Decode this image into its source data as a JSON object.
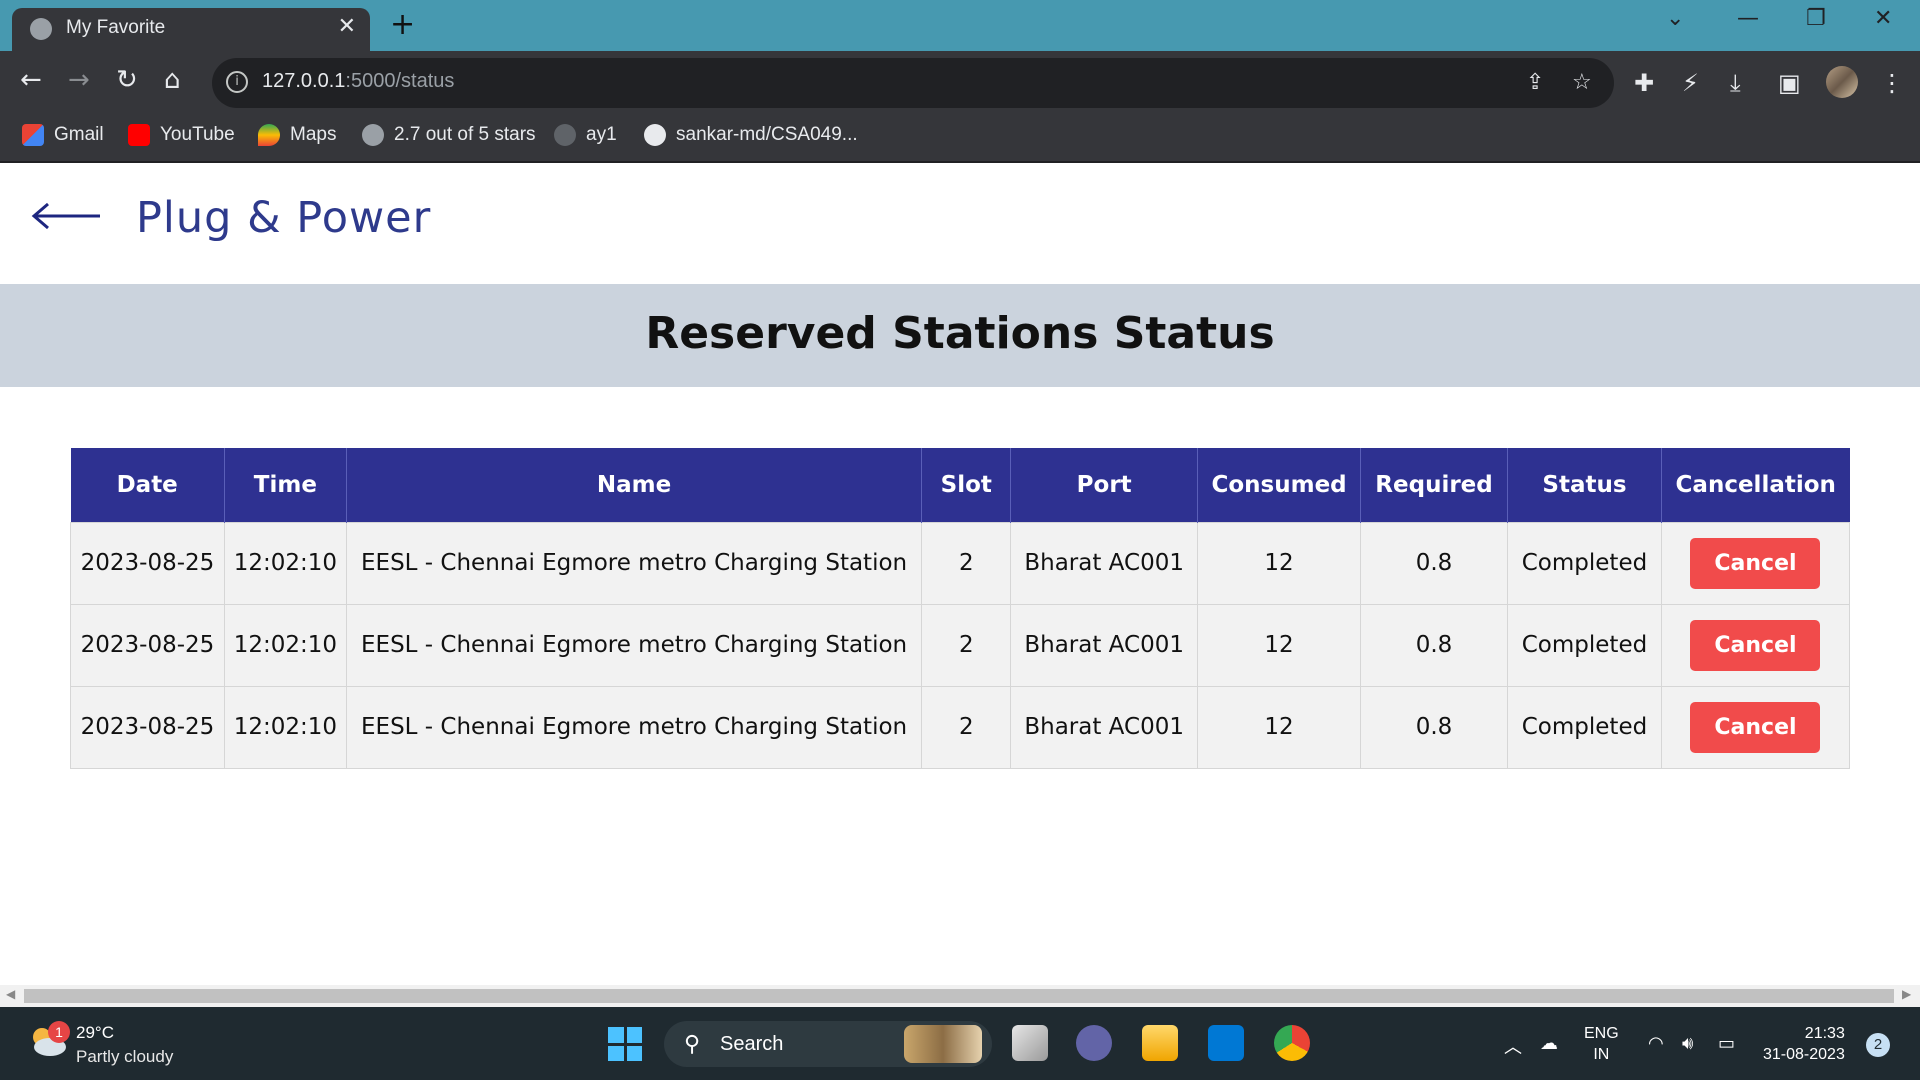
{
  "browser": {
    "tab_title": "My Favorite",
    "tab_close": "✕",
    "new_tab": "+",
    "url_host": "127.0.0.1",
    "url_path": ":5000/status",
    "bookmarks": [
      {
        "label": "Gmail",
        "icon": "gmail-icon"
      },
      {
        "label": "YouTube",
        "icon": "youtube-icon"
      },
      {
        "label": "Maps",
        "icon": "maps-icon"
      },
      {
        "label": "2.7 out of 5 stars",
        "icon": "globe-icon"
      },
      {
        "label": "ay1",
        "icon": "github-icon"
      },
      {
        "label": "sankar-md/CSA049...",
        "icon": "github-icon"
      }
    ]
  },
  "page": {
    "brand": "Plug & Power",
    "heading": "Reserved Stations Status",
    "table": {
      "headers": [
        "Date",
        "Time",
        "Name",
        "Slot",
        "Port",
        "Consumed",
        "Required",
        "Status",
        "Cancellation"
      ],
      "rows": [
        {
          "date": "2023-08-25",
          "time": "12:02:10",
          "name": "EESL - Chennai Egmore metro Charging Station",
          "slot": "2",
          "port": "Bharat AC001",
          "consumed": "12",
          "required": "0.8",
          "status": "Completed",
          "action": "Cancel"
        },
        {
          "date": "2023-08-25",
          "time": "12:02:10",
          "name": "EESL - Chennai Egmore metro Charging Station",
          "slot": "2",
          "port": "Bharat AC001",
          "consumed": "12",
          "required": "0.8",
          "status": "Completed",
          "action": "Cancel"
        },
        {
          "date": "2023-08-25",
          "time": "12:02:10",
          "name": "EESL - Chennai Egmore metro Charging Station",
          "slot": "2",
          "port": "Bharat AC001",
          "consumed": "12",
          "required": "0.8",
          "status": "Completed",
          "action": "Cancel"
        }
      ]
    }
  },
  "taskbar": {
    "weather_badge": "1",
    "temperature": "29°C",
    "condition": "Partly cloudy",
    "search_label": "Search",
    "lang_line1": "ENG",
    "lang_line2": "IN",
    "time": "21:33",
    "date": "31-08-2023",
    "notification_count": "2"
  },
  "colors": {
    "accent": "#2e3191",
    "banner": "#cbd3dd",
    "cancel": "#f14b4b",
    "tabbar": "#4799b0"
  }
}
